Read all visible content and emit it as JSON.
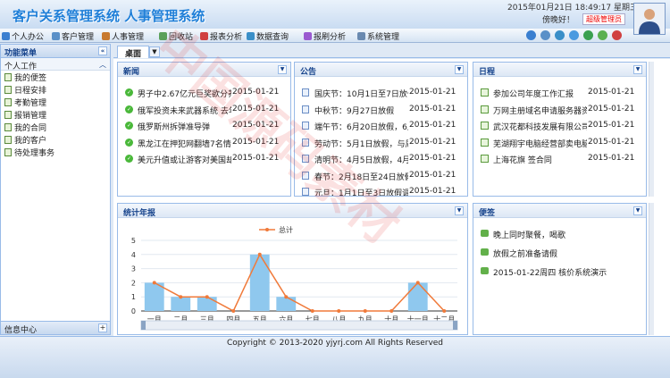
{
  "header": {
    "title": "客户关系管理系统 人事管理系统",
    "date": "2015年01月21日 18:49:17 星期三",
    "greeting": "傍晚好！",
    "role": "超级管理员"
  },
  "menu": [
    {
      "label": "个人办公",
      "icon": "person-icon",
      "color": "#3a7fd0"
    },
    {
      "label": "客户管理",
      "icon": "customer-icon",
      "color": "#5a90c8"
    },
    {
      "label": "人事管理",
      "icon": "hr-icon",
      "color": "#c87a30"
    },
    {
      "label": "回收站",
      "icon": "recycle-icon",
      "color": "#5aa05a"
    },
    {
      "label": "报表分析",
      "icon": "report-icon",
      "color": "#d04040"
    },
    {
      "label": "数据查询",
      "icon": "query-icon",
      "color": "#3a8fc8"
    },
    {
      "label": "报刷分析",
      "icon": "analysis-icon",
      "color": "#9a5ad0"
    },
    {
      "label": "系统管理",
      "icon": "gear-icon",
      "color": "#6a8ab0"
    }
  ],
  "top_icons": [
    {
      "name": "home-icon",
      "color": "#3a7fd0"
    },
    {
      "name": "lock-icon",
      "color": "#5a90c8"
    },
    {
      "name": "settings-icon",
      "color": "#3a8fc8"
    },
    {
      "name": "help-icon",
      "color": "#4a9ae0"
    },
    {
      "name": "refresh-icon",
      "color": "#3aa050"
    },
    {
      "name": "message-icon",
      "color": "#5ab050"
    },
    {
      "name": "exit-icon",
      "color": "#d04040"
    }
  ],
  "sidebar": {
    "title": "功能菜单",
    "group": "个人工作",
    "items": [
      "我的便签",
      "日程安排",
      "考勤管理",
      "报销管理",
      "我的合同",
      "我的客户",
      "待处理事务"
    ],
    "footer": "信息中心"
  },
  "tabs": [
    "桌面"
  ],
  "news": {
    "title": "新闻",
    "rows": [
      {
        "text": "男子中2.67亿元巨奖欲分养",
        "date": "2015-01-21"
      },
      {
        "text": "俄军投资未来武器系统 去年",
        "date": "2015-01-21"
      },
      {
        "text": "俄罗斯州拆弹准导弹",
        "date": "2015-01-21"
      },
      {
        "text": "黑龙江在押犯网翻墙7名情人",
        "date": "2015-01-21"
      },
      {
        "text": "美元升值或让游客对美国却步",
        "date": "2015-01-21"
      }
    ]
  },
  "notice": {
    "title": "公告",
    "rows": [
      {
        "text": "国庆节：10月1日至7日放假",
        "date": "2015-01-21"
      },
      {
        "text": "中秋节：9月27日放假",
        "date": "2015-01-21"
      },
      {
        "text": "端午节：6月20日放假，6月",
        "date": "2015-01-21"
      },
      {
        "text": "劳动节：5月1日放假，与周",
        "date": "2015-01-21"
      },
      {
        "text": "清明节：4月5日放假，4月6",
        "date": "2015-01-21"
      },
      {
        "text": "春节：2月18日至24日放假",
        "date": "2015-01-21"
      },
      {
        "text": "元旦：1月1日至3日放假调",
        "date": "2015-01-21"
      }
    ]
  },
  "schedule": {
    "title": "日程",
    "rows": [
      {
        "text": "参加公司年度工作汇报",
        "date": "2015-01-21"
      },
      {
        "text": "万网主册域名申请服务器资源",
        "date": "2015-01-21"
      },
      {
        "text": "武汉花都科技发展有限公司签",
        "date": "2015-01-21"
      },
      {
        "text": "芜湖翔宇电脑经营部卖电脑",
        "date": "2015-01-21"
      },
      {
        "text": "上海花旗 签合同",
        "date": "2015-01-21"
      }
    ]
  },
  "stats": {
    "title": "统计年报"
  },
  "memo": {
    "title": "便签",
    "rows": [
      "晚上同时聚餐，喝歌",
      "放假之前准备请假",
      "2015-01-22周四 核价系统演示"
    ]
  },
  "chart_data": {
    "type": "bar",
    "categories": [
      "一月",
      "二月",
      "三月",
      "四月",
      "五月",
      "六月",
      "七月",
      "八月",
      "九月",
      "十月",
      "十一月",
      "十二月"
    ],
    "series": [
      {
        "name": "总计",
        "type": "bar",
        "values": [
          2,
          1,
          1,
          0,
          4,
          1,
          0,
          0,
          0,
          0,
          2,
          0
        ]
      },
      {
        "name": "总计",
        "type": "line",
        "values": [
          2,
          1,
          1,
          0,
          4,
          1,
          0,
          0,
          0,
          0,
          2,
          0
        ]
      }
    ],
    "ylim": [
      0,
      5
    ],
    "yticks": [
      0,
      1,
      2,
      3,
      4,
      5
    ],
    "legend": "top",
    "bar_color": "#8fc8ee",
    "line_color": "#f07a3a"
  },
  "footer": {
    "copyright": "Copyright © 2013-2020 yjyrj.com All Rights Reserved"
  },
  "watermark": "中国源码素材"
}
